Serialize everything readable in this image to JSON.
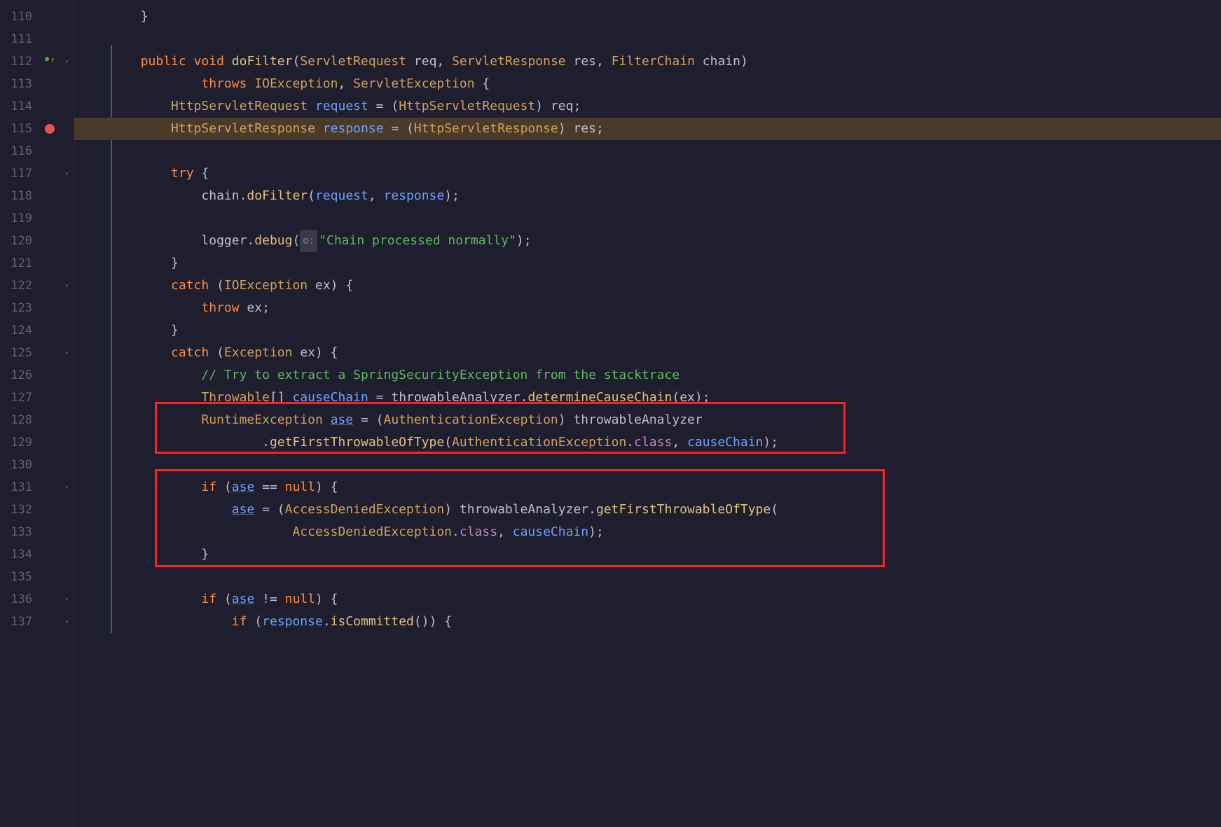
{
  "lines": {
    "start": 110,
    "end": 137
  },
  "breakpointLine": 115,
  "overrideLine": 112,
  "code": {
    "l110": "        }",
    "l111": "",
    "l112_kw1": "public",
    "l112_kw2": "void",
    "l112_method": "doFilter",
    "l112_t1": "ServletRequest",
    "l112_p1": "req",
    "l112_t2": "ServletResponse",
    "l112_p2": "res",
    "l112_t3": "FilterChain",
    "l112_p3": "chain",
    "l113_kw": "throws",
    "l113_t1": "IOException",
    "l113_t2": "ServletException",
    "l114_t1": "HttpServletRequest",
    "l114_v": "request",
    "l114_t2": "HttpServletRequest",
    "l114_p": "req",
    "l115_t1": "HttpServletResponse",
    "l115_v": "response",
    "l115_t2": "HttpServletResponse",
    "l115_p": "res",
    "l117_kw": "try",
    "l118_field": "chain",
    "l118_m": "doFilter",
    "l118_a1": "request",
    "l118_a2": "response",
    "l120_field": "logger",
    "l120_m": "debug",
    "l120_str": "\"Chain processed normally\"",
    "l122_kw": "catch",
    "l122_t": "IOException",
    "l122_v": "ex",
    "l123_kw": "throw",
    "l123_v": "ex",
    "l125_kw": "catch",
    "l125_t": "Exception",
    "l125_v": "ex",
    "l126_c": "// Try to extract a SpringSecurityException from the stacktrace",
    "l127_t": "Throwable",
    "l127_v": "causeChain",
    "l127_f": "throwableAnalyzer",
    "l127_m": "determineCauseChain",
    "l127_a": "ex",
    "l128_t": "RuntimeException",
    "l128_v": "ase",
    "l128_ct": "AuthenticationException",
    "l128_f": "throwableAnalyzer",
    "l129_m": "getFirstThrowableOfType",
    "l129_t": "AuthenticationException",
    "l129_kf": "class",
    "l129_a": "causeChain",
    "l131_kw": "if",
    "l131_v": "ase",
    "l131_kw2": "null",
    "l132_v": "ase",
    "l132_ct": "AccessDeniedException",
    "l132_f": "throwableAnalyzer",
    "l132_m": "getFirstThrowableOfType",
    "l133_t": "AccessDeniedException",
    "l133_kf": "class",
    "l133_a": "causeChain",
    "l136_kw": "if",
    "l136_v": "ase",
    "l136_kw2": "null",
    "l137_kw": "if",
    "l137_v": "response",
    "l137_m": "isCommitted"
  }
}
